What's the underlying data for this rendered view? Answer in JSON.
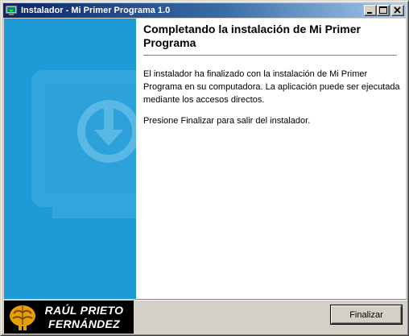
{
  "window": {
    "title": "Instalador - Mi Primer Programa 1.0"
  },
  "content": {
    "heading": "Completando la instalación de Mi Primer Programa",
    "paragraph1": "El instalador ha finalizado con la instalación de Mi Primer Programa en su computadora. La aplicación puede ser ejecutada mediante los accesos directos.",
    "paragraph2": "Presione Finalizar para salir del instalador."
  },
  "brand": {
    "line1": "RAÚL PRIETO",
    "line2": "FERNÁNDEZ"
  },
  "buttons": {
    "finish": "Finalizar"
  },
  "icons": {
    "app": "installer-icon",
    "minimize": "minimize-icon",
    "maximize": "maximize-icon",
    "close": "close-icon",
    "sidebar": "monitor-download-icon",
    "logo": "brain-logo-icon"
  },
  "colors": {
    "titlebar_start": "#0a246a",
    "titlebar_end": "#a6caf0",
    "sidebar": "#1e9ad6",
    "brand_background": "#000000"
  }
}
